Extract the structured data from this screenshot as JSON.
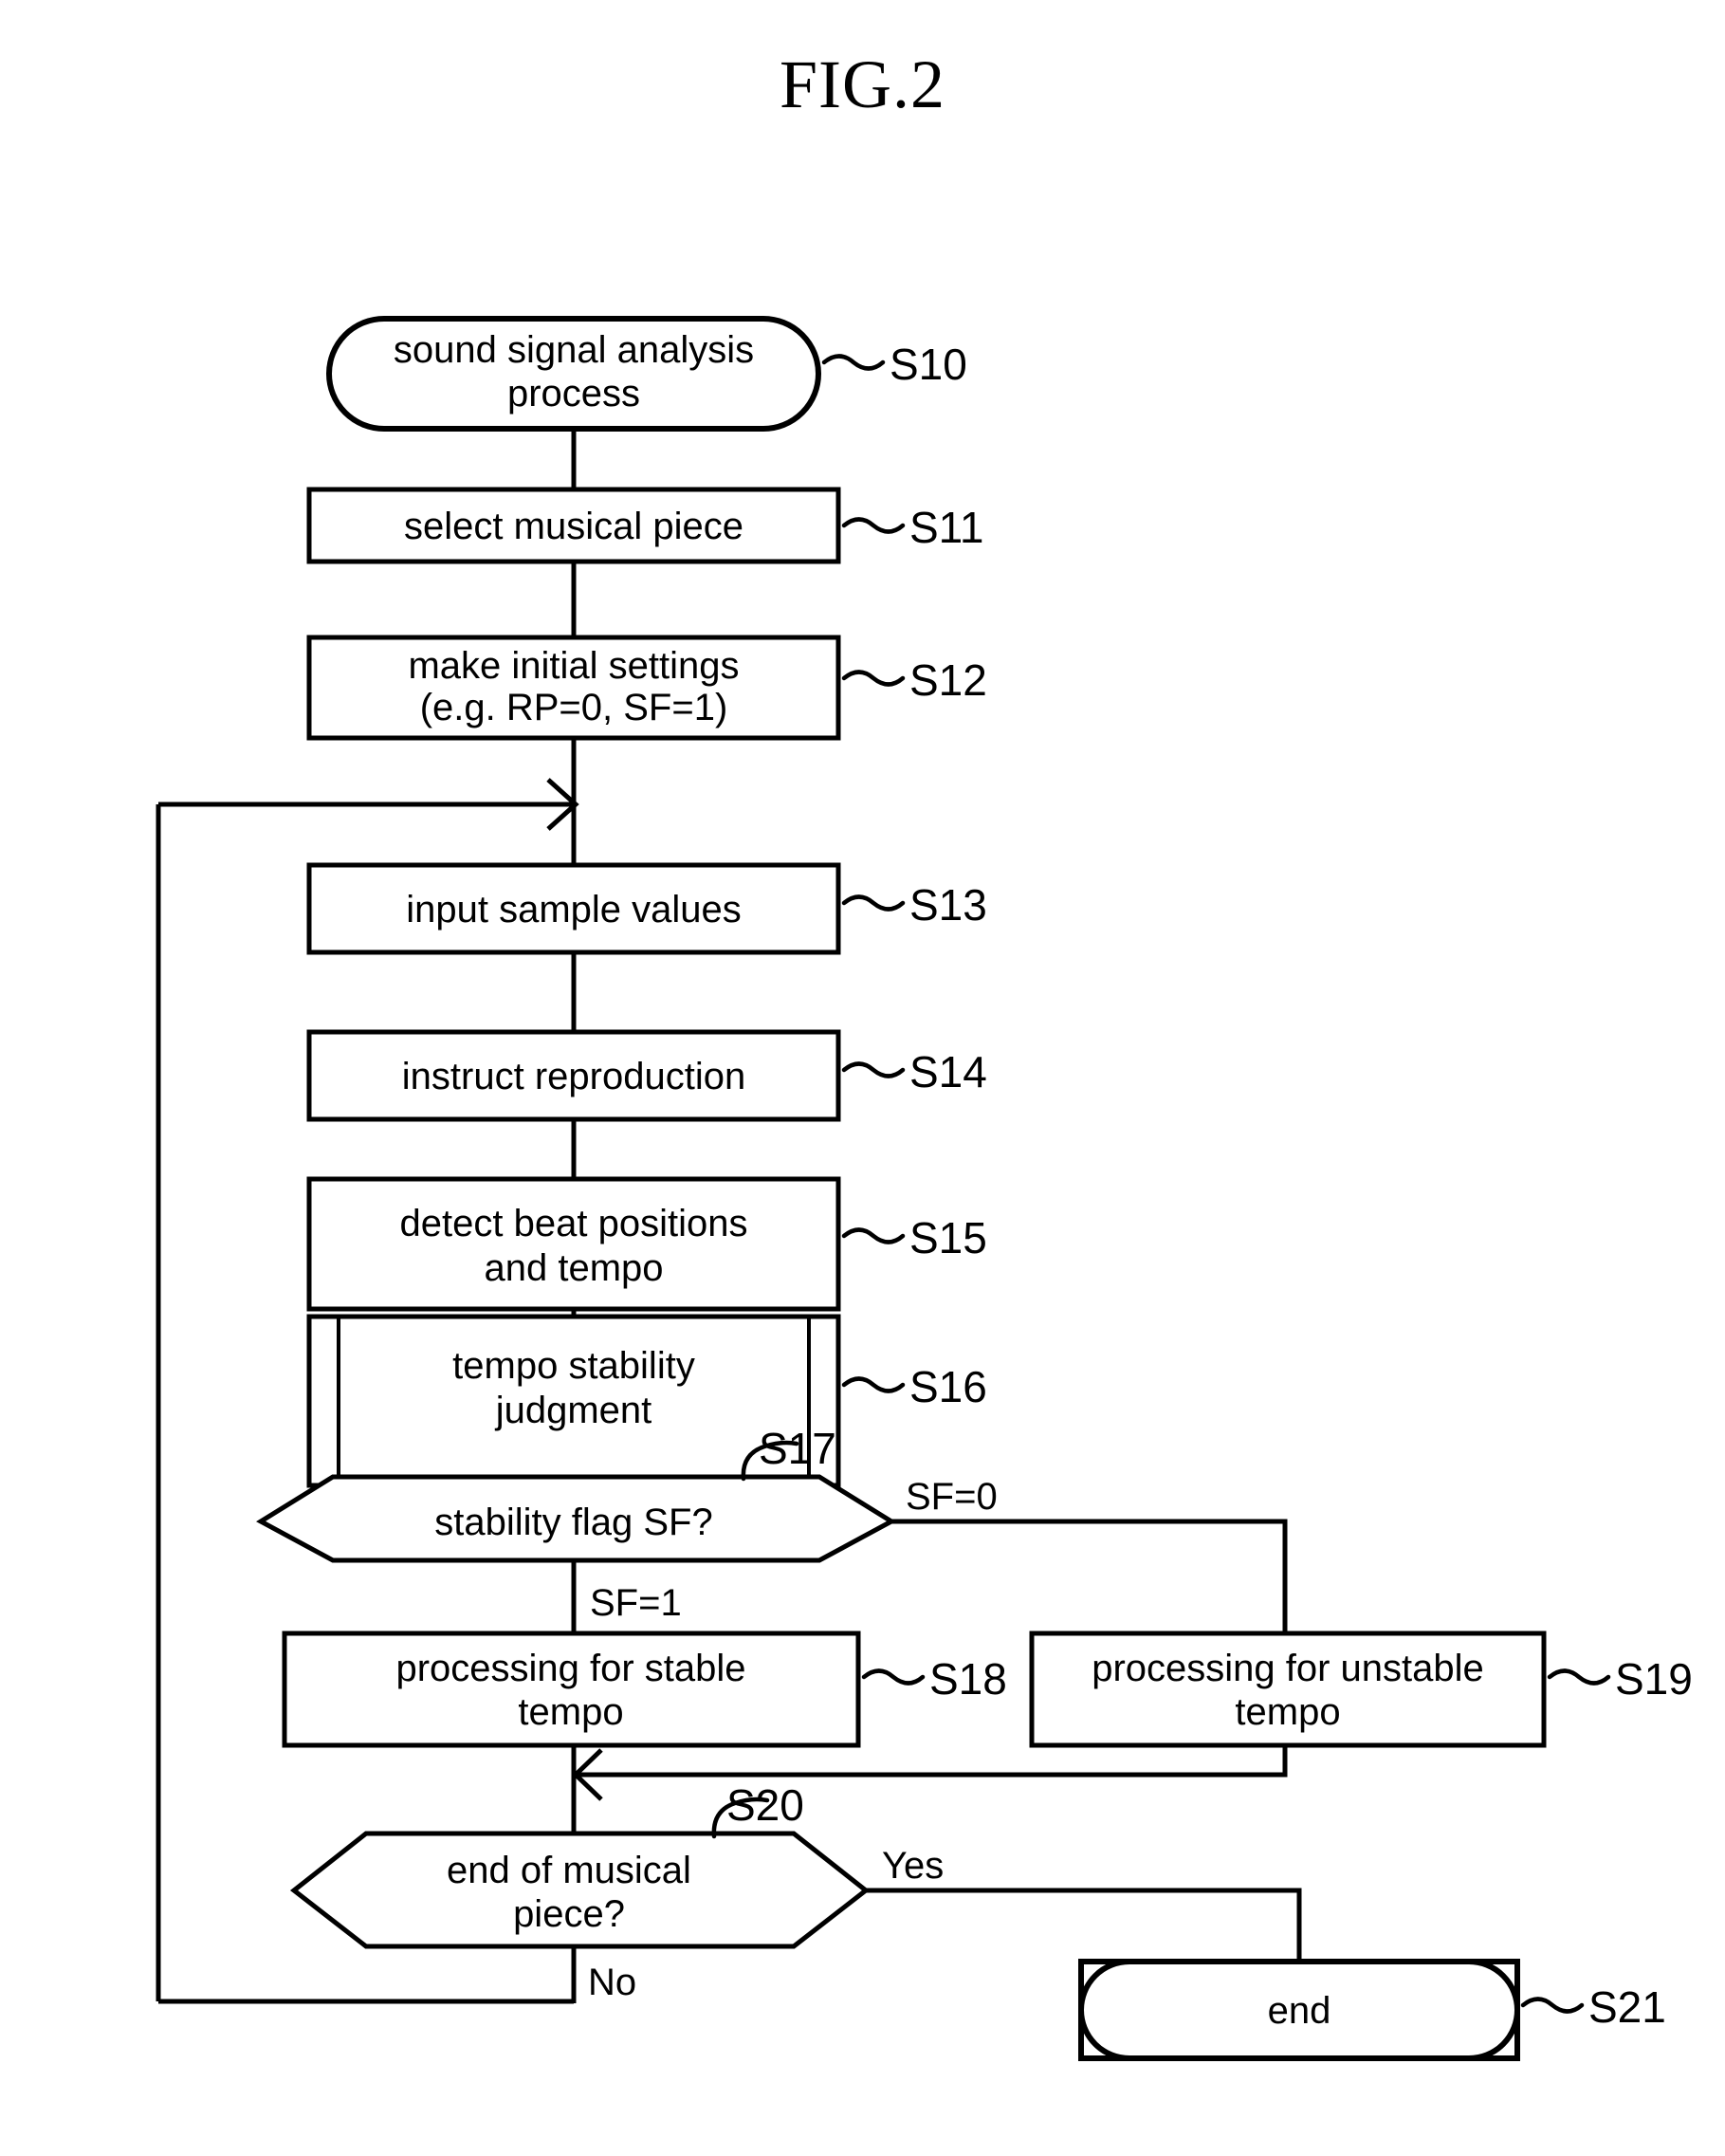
{
  "figure": {
    "title": "FIG.2",
    "type": "patent-flowchart",
    "background_color": "#ffffff",
    "line_color": "#000000"
  },
  "nodes": [
    {
      "id": "S10",
      "shape": "terminator",
      "step_ref": "S10",
      "lines": [
        "sound signal analysis",
        "process"
      ]
    },
    {
      "id": "S11",
      "shape": "process",
      "step_ref": "S11",
      "lines": [
        "select musical piece"
      ]
    },
    {
      "id": "S12",
      "shape": "process",
      "step_ref": "S12",
      "lines": [
        "make initial settings",
        "(e.g. RP=0, SF=1)"
      ]
    },
    {
      "id": "S13",
      "shape": "process",
      "step_ref": "S13",
      "lines": [
        "input sample values"
      ]
    },
    {
      "id": "S14",
      "shape": "process",
      "step_ref": "S14",
      "lines": [
        "instruct reproduction"
      ]
    },
    {
      "id": "S15",
      "shape": "process",
      "step_ref": "S15",
      "lines": [
        "detect beat positions",
        "and tempo"
      ]
    },
    {
      "id": "S16",
      "shape": "predefined-process",
      "step_ref": "S16",
      "lines": [
        "tempo stability",
        "judgment"
      ]
    },
    {
      "id": "S17",
      "shape": "decision-hexagon",
      "step_ref": "S17",
      "lines": [
        "stability flag SF?"
      ]
    },
    {
      "id": "S18",
      "shape": "process",
      "step_ref": "S18",
      "lines": [
        "processing for stable",
        "tempo"
      ]
    },
    {
      "id": "S19",
      "shape": "process",
      "step_ref": "S19",
      "lines": [
        "processing for unstable",
        "tempo"
      ]
    },
    {
      "id": "S20",
      "shape": "decision-hexagon",
      "step_ref": "S20",
      "lines": [
        "end of musical",
        "piece?"
      ]
    },
    {
      "id": "S21",
      "shape": "terminator",
      "step_ref": "S21",
      "lines": [
        "end"
      ]
    }
  ],
  "edge_labels": {
    "sf_zero": "SF=0",
    "sf_one": "SF=1",
    "yes": "Yes",
    "no": "No"
  },
  "node_text": {
    "s10_line1": "sound signal analysis",
    "s10_line2": "process",
    "s11_line1": "select musical piece",
    "s12_line1": "make initial settings",
    "s12_line2": "(e.g. RP=0, SF=1)",
    "s13_line1": "input sample values",
    "s14_line1": "instruct reproduction",
    "s15_line1": "detect beat positions",
    "s15_line2": "and tempo",
    "s16_line1": "tempo stability",
    "s16_line2": "judgment",
    "s17_line1": "stability flag SF?",
    "s18_line1": "processing for stable",
    "s18_line2": "tempo",
    "s19_line1": "processing for unstable",
    "s19_line2": "tempo",
    "s20_line1": "end of musical",
    "s20_line2": "piece?",
    "s21_line1": "end"
  },
  "step_refs": {
    "s10": "S10",
    "s11": "S11",
    "s12": "S12",
    "s13": "S13",
    "s14": "S14",
    "s15": "S15",
    "s16": "S16",
    "s17": "S17",
    "s18": "S18",
    "s19": "S19",
    "s20": "S20",
    "s21": "S21"
  }
}
